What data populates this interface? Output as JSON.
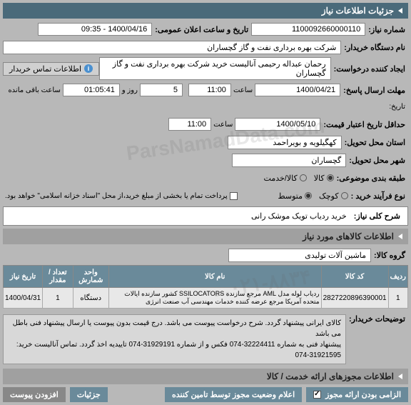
{
  "header": {
    "title": "جزئیات اطلاعات نیاز"
  },
  "fields": {
    "need_no_label": "شماره نیاز:",
    "need_no": "1100092660000110",
    "pub_datetime_label": "تاریخ و ساعت اعلان عمومی:",
    "pub_datetime": "1400/04/16 - 09:35",
    "buyer_label": "نام دستگاه خریدار:",
    "buyer": "شرکت بهره برداری نفت و گاز گچساران",
    "creator_label": "ایجاد کننده درخواست:",
    "creator": "رحمان عبداله رحیمی آنالیست خرید شرکت بهره برداری نفت و گاز گچساران",
    "contact_btn": "اطلاعات تماس خریدار",
    "deadline_label": "مهلت ارسال پاسخ:",
    "deadline_date": "1400/04/21",
    "time_label": "ساعت",
    "deadline_time": "11:00",
    "days_remaining": "5",
    "days_label": "روز و",
    "time_remaining": "01:05:41",
    "remain_label": "ساعت باقی مانده",
    "tarikh_label": "تاریخ:",
    "validity_label": "حداقل تاریخ اعتبار قیمت:",
    "validity_date": "1400/05/10",
    "validity_time": "11:00",
    "province_label": "استان محل تحویل:",
    "province": "کهگیلویه و بویراحمد",
    "city_label": "شهر محل تحویل:",
    "city": "گچساران",
    "class_label": "طبقه بندی موضوعی:",
    "class_goods": "کالا",
    "class_service": "کالا/خدمت",
    "process_label": "نوع فرآیند خرید :",
    "proc_small": "کوچک",
    "proc_medium": "متوسط",
    "pay_note": "پرداخت تمام یا بخشی از مبلغ خرید،از محل \"اسناد خزانه اسلامی\" خواهد بود."
  },
  "desc": {
    "title_label": "شرح کلی نیاز:",
    "title": "خرید ردیاب تویک موشک رانی"
  },
  "goods_section": {
    "header": "اطلاعات کالاهای مورد نیاز",
    "group_label": "گروه کالا:",
    "group": "ماشین آلات تولیدی"
  },
  "table": {
    "headers": {
      "row": "ردیف",
      "code": "کد کالا",
      "name": "نام کالا",
      "unit": "واحد شمارش",
      "qty": "تعداد / مقدار",
      "date": "تاریخ نیاز"
    },
    "rows": [
      {
        "row": "1",
        "code": "2827220896390001",
        "name": "ردیاب لوله مدل AML مرجع سازنده SSILOCATORS کشور سازنده ایالات متحده آمریکا مرجع عرضه کننده خدمات مهندسی آب صنعت انرژی",
        "unit": "دستگاه",
        "qty": "1",
        "date": "1400/04/31"
      }
    ]
  },
  "buyer_notes": {
    "label": "توضیحات خریدار:",
    "text": "کالای ایرانی پیشنهاد گردد. شرح درخواست پیوست می باشد. درج قیمت بدون پیوست یا ارسال پیشنهاد فنی باطل می باشد\nپیشنهاد فنی به شماره 32224411-074 فکس و از شماره 31929191-074 تاییدیه اخذ گردد. تماس آنالیست خرید: 31921595-074"
  },
  "license_section": {
    "header": "اطلاعات مجوزهای ارائه خدمت / کالا"
  },
  "footer": {
    "required_label": "الزامی بودن ارائه مجوز",
    "auth_label": "اعلام وضعیت مجوز توسط تامین کننده",
    "details": "جزئیات",
    "attach": "افزودن پیوست"
  }
}
